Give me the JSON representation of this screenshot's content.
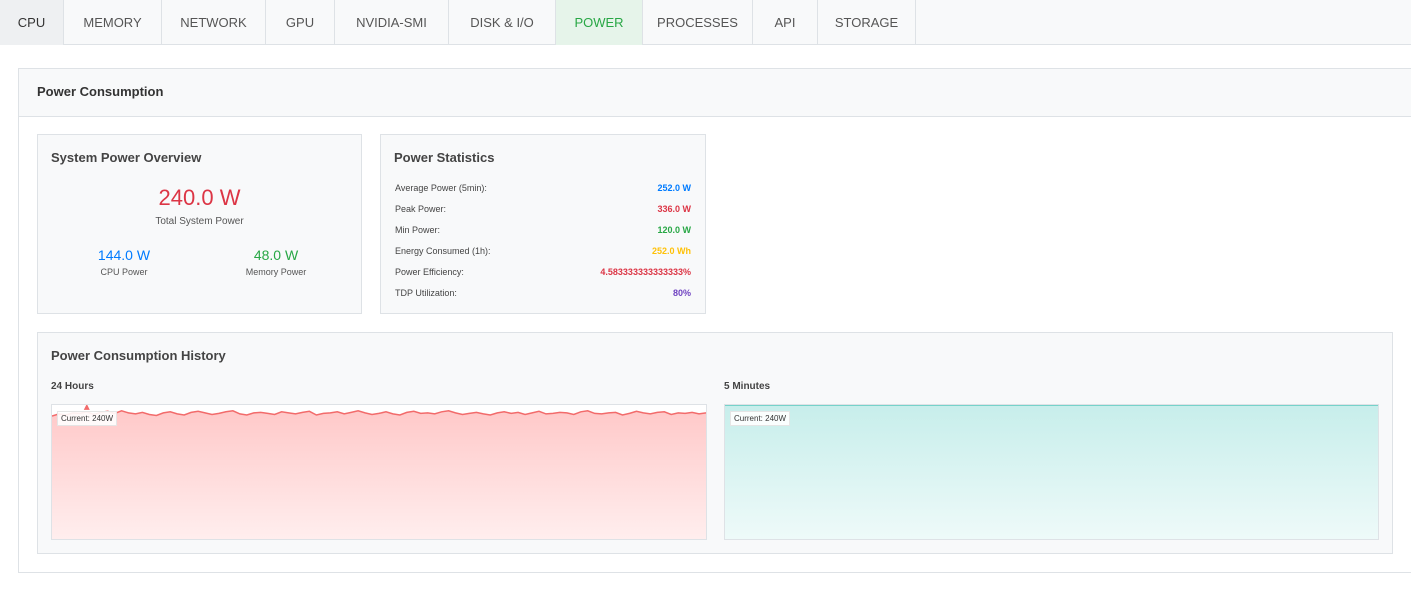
{
  "tabs": [
    "CPU",
    "MEMORY",
    "NETWORK",
    "GPU",
    "NVIDIA-SMI",
    "DISK & I/O",
    "POWER",
    "PROCESSES",
    "API",
    "STORAGE"
  ],
  "active_tab": "POWER",
  "panel_title": "Power Consumption",
  "overview": {
    "title": "System Power Overview",
    "total_value": "240.0 W",
    "total_label": "Total System Power",
    "cpu_value": "144.0 W",
    "cpu_label": "CPU Power",
    "memory_value": "48.0 W",
    "memory_label": "Memory Power"
  },
  "stats": {
    "title": "Power Statistics",
    "rows": [
      {
        "label": "Average Power (5min):",
        "value": "252.0 W",
        "color": "#007bff"
      },
      {
        "label": "Peak Power:",
        "value": "336.0 W",
        "color": "#dc3545"
      },
      {
        "label": "Min Power:",
        "value": "120.0 W",
        "color": "#28a745"
      },
      {
        "label": "Energy Consumed (1h):",
        "value": "252.0 Wh",
        "color": "#ffc107"
      },
      {
        "label": "Power Efficiency:",
        "value": "4.583333333333333%",
        "color": "#dc3545"
      },
      {
        "label": "TDP Utilization:",
        "value": "80%",
        "color": "#6f42c1"
      }
    ]
  },
  "history": {
    "title": "Power Consumption History",
    "chart_24h": {
      "title": "24 Hours",
      "current": "Current: 240W",
      "color": "#f26b6b"
    },
    "chart_5m": {
      "title": "5 Minutes",
      "current": "Current: 240W",
      "color": "#5cc9c0"
    }
  },
  "chart_data": [
    {
      "type": "area",
      "title": "24 Hours",
      "ylim": [
        0,
        336
      ],
      "values": [
        234,
        238,
        236,
        240,
        239,
        242,
        237,
        241,
        243,
        239,
        244,
        240,
        238,
        241,
        237,
        235,
        240,
        242,
        238,
        236,
        241,
        243,
        240,
        237,
        239,
        242,
        244,
        238,
        236,
        240,
        241,
        239,
        237,
        242,
        240,
        238,
        241,
        243,
        236,
        239,
        240,
        242,
        238,
        241,
        244,
        240,
        237,
        239,
        242,
        238,
        236,
        241,
        243,
        239,
        240,
        238,
        242,
        244,
        240,
        237,
        239,
        241,
        238,
        236,
        240,
        242,
        239,
        241,
        237,
        240,
        243,
        238,
        239,
        241,
        240,
        237,
        242,
        244,
        239,
        238,
        240,
        241,
        236,
        239,
        243,
        240,
        238,
        241,
        242,
        237,
        240,
        239,
        241,
        238,
        240
      ]
    },
    {
      "type": "area",
      "title": "5 Minutes",
      "ylim": [
        0,
        240
      ],
      "values": [
        240,
        240,
        240,
        240,
        240,
        240,
        240,
        240,
        240,
        240,
        240,
        240,
        240,
        240,
        240,
        240,
        240,
        240,
        240,
        240
      ]
    }
  ]
}
